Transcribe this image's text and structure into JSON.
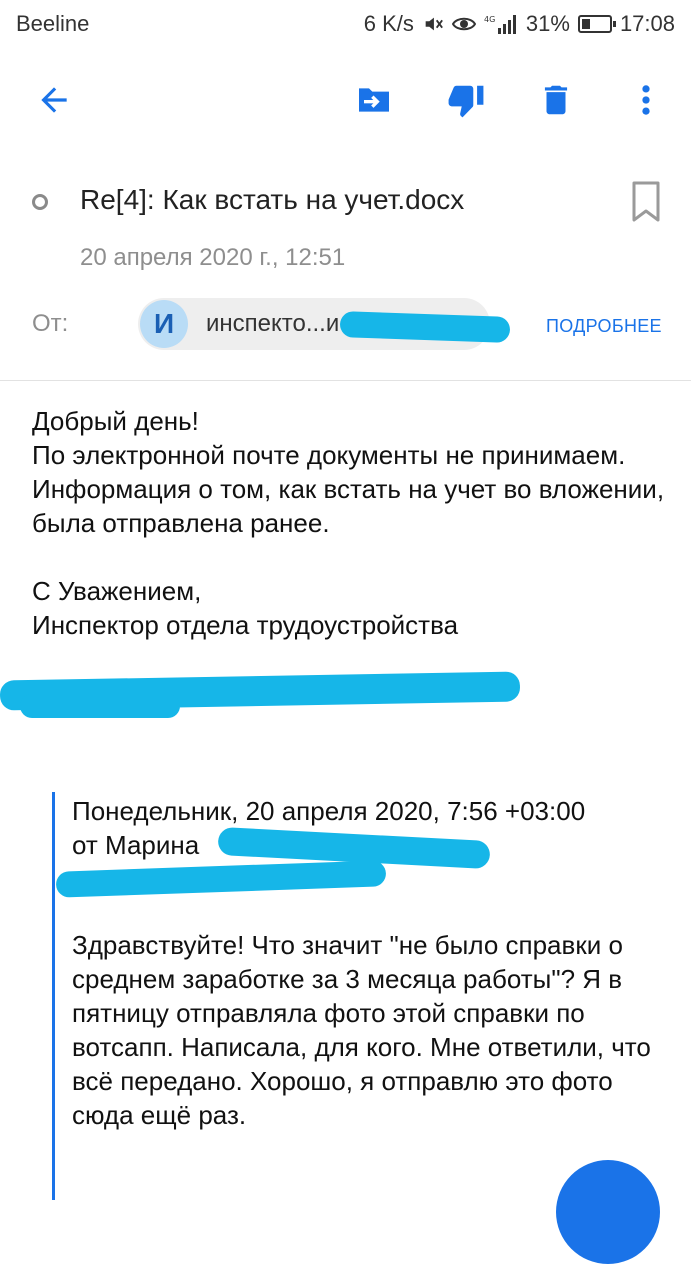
{
  "status_bar": {
    "carrier": "Beeline",
    "speed": "6 K/s",
    "network": "4G",
    "battery": "31%",
    "time": "17:08"
  },
  "toolbar": {
    "back_icon": "arrow-left-icon",
    "move_icon": "move-to-folder-icon",
    "spam_icon": "thumb-down-icon",
    "delete_icon": "trash-icon",
    "more_icon": "more-vertical-icon"
  },
  "message": {
    "subject": "Re[4]: Как встать на учет.docx",
    "date": "20 апреля 2020 г., 12:51",
    "from_label": "От:",
    "sender_initial": "И",
    "sender_name": "инспекто...и",
    "details_link": "ПОДРОБНЕЕ",
    "body": {
      "line1": "Добрый день!",
      "line2": "По электронной почте документы не принимаем.",
      "line3": "Информация о том, как встать на учет во вложении, была отправлена ранее.",
      "sign1": "С Уважением,",
      "sign2": "Инспектор отдела трудоустройства"
    },
    "quoted": {
      "header_line1": "Понедельник, 20 апреля 2020, 7:56 +03:00",
      "header_line2": "от Марина",
      "text": "Здравствуйте! Что значит \"не было справки о среднем заработке за 3 месяца работы\"? Я в пятницу отправляла фото этой справки по вотсапп. Написала, для кого. Мне ответили, что всё передано. Хорошо, я отправлю это фото сюда ещё раз."
    }
  },
  "colors": {
    "accent": "#1a73e8",
    "redaction": "#16b6e8"
  }
}
